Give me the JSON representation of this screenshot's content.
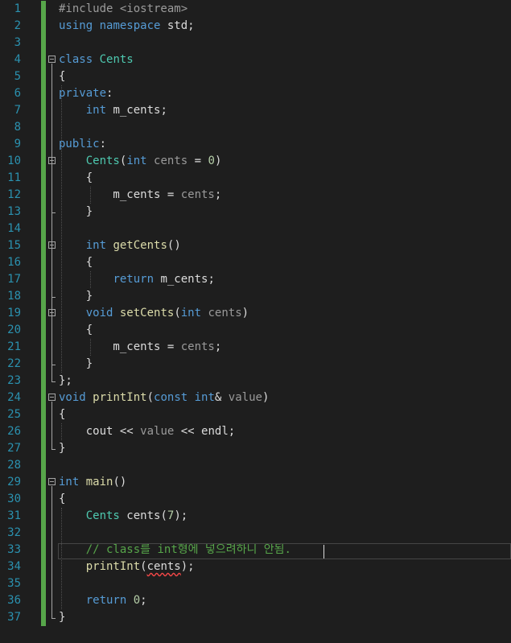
{
  "editor": {
    "language": "cpp",
    "line_numbers": [
      "1",
      "2",
      "3",
      "4",
      "5",
      "6",
      "7",
      "8",
      "9",
      "10",
      "11",
      "12",
      "13",
      "14",
      "15",
      "16",
      "17",
      "18",
      "19",
      "20",
      "21",
      "22",
      "23",
      "24",
      "25",
      "26",
      "27",
      "28",
      "29",
      "30",
      "31",
      "32",
      "33",
      "34",
      "35",
      "36",
      "37"
    ],
    "lines": [
      [
        {
          "t": "#include <iostream>",
          "c": "pre"
        }
      ],
      [
        {
          "t": "using",
          "c": "kw"
        },
        {
          "t": " ",
          "c": "tx"
        },
        {
          "t": "namespace",
          "c": "kw"
        },
        {
          "t": " std;",
          "c": "tx"
        }
      ],
      [],
      [
        {
          "t": "class",
          "c": "kw"
        },
        {
          "t": " ",
          "c": "tx"
        },
        {
          "t": "Cents",
          "c": "ty"
        }
      ],
      [
        {
          "t": "{",
          "c": "tx"
        }
      ],
      [
        {
          "t": "private",
          "c": "kw"
        },
        {
          "t": ":",
          "c": "tx"
        }
      ],
      [
        {
          "t": "    ",
          "c": "tx"
        },
        {
          "t": "int",
          "c": "kw"
        },
        {
          "t": " m_cents;",
          "c": "tx"
        }
      ],
      [],
      [
        {
          "t": "public",
          "c": "kw"
        },
        {
          "t": ":",
          "c": "tx"
        }
      ],
      [
        {
          "t": "    ",
          "c": "tx"
        },
        {
          "t": "Cents",
          "c": "ty"
        },
        {
          "t": "(",
          "c": "tx"
        },
        {
          "t": "int",
          "c": "kw"
        },
        {
          "t": " ",
          "c": "tx"
        },
        {
          "t": "cents",
          "c": "pm"
        },
        {
          "t": " = ",
          "c": "tx"
        },
        {
          "t": "0",
          "c": "num"
        },
        {
          "t": ")",
          "c": "tx"
        }
      ],
      [
        {
          "t": "    {",
          "c": "tx"
        }
      ],
      [
        {
          "t": "        m_cents = ",
          "c": "tx"
        },
        {
          "t": "cents",
          "c": "pm"
        },
        {
          "t": ";",
          "c": "tx"
        }
      ],
      [
        {
          "t": "    }",
          "c": "tx"
        }
      ],
      [],
      [
        {
          "t": "    ",
          "c": "tx"
        },
        {
          "t": "int",
          "c": "kw"
        },
        {
          "t": " ",
          "c": "tx"
        },
        {
          "t": "getCents",
          "c": "fn"
        },
        {
          "t": "()",
          "c": "tx"
        }
      ],
      [
        {
          "t": "    {",
          "c": "tx"
        }
      ],
      [
        {
          "t": "        ",
          "c": "tx"
        },
        {
          "t": "return",
          "c": "kw"
        },
        {
          "t": " m_cents;",
          "c": "tx"
        }
      ],
      [
        {
          "t": "    }",
          "c": "tx"
        }
      ],
      [
        {
          "t": "    ",
          "c": "tx"
        },
        {
          "t": "void",
          "c": "kw"
        },
        {
          "t": " ",
          "c": "tx"
        },
        {
          "t": "setCents",
          "c": "fn"
        },
        {
          "t": "(",
          "c": "tx"
        },
        {
          "t": "int",
          "c": "kw"
        },
        {
          "t": " ",
          "c": "tx"
        },
        {
          "t": "cents",
          "c": "pm"
        },
        {
          "t": ")",
          "c": "tx"
        }
      ],
      [
        {
          "t": "    {",
          "c": "tx"
        }
      ],
      [
        {
          "t": "        m_cents = ",
          "c": "tx"
        },
        {
          "t": "cents",
          "c": "pm"
        },
        {
          "t": ";",
          "c": "tx"
        }
      ],
      [
        {
          "t": "    }",
          "c": "tx"
        }
      ],
      [
        {
          "t": "};",
          "c": "tx"
        }
      ],
      [
        {
          "t": "void",
          "c": "kw"
        },
        {
          "t": " ",
          "c": "tx"
        },
        {
          "t": "printInt",
          "c": "fn"
        },
        {
          "t": "(",
          "c": "tx"
        },
        {
          "t": "const",
          "c": "kw"
        },
        {
          "t": " ",
          "c": "tx"
        },
        {
          "t": "int",
          "c": "kw"
        },
        {
          "t": "& ",
          "c": "tx"
        },
        {
          "t": "value",
          "c": "pm"
        },
        {
          "t": ")",
          "c": "tx"
        }
      ],
      [
        {
          "t": "{",
          "c": "tx"
        }
      ],
      [
        {
          "t": "    cout << ",
          "c": "tx"
        },
        {
          "t": "value",
          "c": "pm"
        },
        {
          "t": " << endl;",
          "c": "tx"
        }
      ],
      [
        {
          "t": "}",
          "c": "tx"
        }
      ],
      [],
      [
        {
          "t": "int",
          "c": "kw"
        },
        {
          "t": " ",
          "c": "tx"
        },
        {
          "t": "main",
          "c": "fn"
        },
        {
          "t": "()",
          "c": "tx"
        }
      ],
      [
        {
          "t": "{",
          "c": "tx"
        }
      ],
      [
        {
          "t": "    ",
          "c": "tx"
        },
        {
          "t": "Cents",
          "c": "ty"
        },
        {
          "t": " cents(",
          "c": "tx"
        },
        {
          "t": "7",
          "c": "num"
        },
        {
          "t": ");",
          "c": "tx"
        }
      ],
      [],
      [
        {
          "t": "    ",
          "c": "tx"
        },
        {
          "t": "// class를 int형에 넣으려하니 안됨.",
          "c": "cm"
        }
      ],
      [
        {
          "t": "    ",
          "c": "tx"
        },
        {
          "t": "printInt",
          "c": "fn"
        },
        {
          "t": "(",
          "c": "tx"
        },
        {
          "t": "cents",
          "c": "tx",
          "err": true
        },
        {
          "t": ");",
          "c": "tx"
        }
      ],
      [],
      [
        {
          "t": "    ",
          "c": "tx"
        },
        {
          "t": "return",
          "c": "kw"
        },
        {
          "t": " ",
          "c": "tx"
        },
        {
          "t": "0",
          "c": "num"
        },
        {
          "t": ";",
          "c": "tx"
        }
      ],
      [
        {
          "t": "}",
          "c": "tx"
        }
      ]
    ],
    "current_line": 33,
    "colors": {
      "background": "#1e1e1e",
      "line_number": "#2b91af",
      "change_bar": "#57a64a",
      "keyword": "#569cd6",
      "type": "#4ec9b0",
      "function": "#dcdcaa",
      "comment": "#57a64a",
      "number": "#b5cea8",
      "error_squiggle": "#f44747"
    },
    "icons": {
      "fold_marker": "collapse-minus-icon"
    }
  }
}
